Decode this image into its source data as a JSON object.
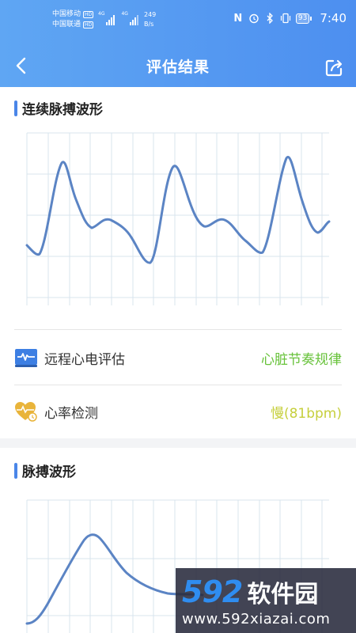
{
  "status_bar": {
    "carrier1": "中国移动",
    "carrier2": "中国联通",
    "hd": "HD",
    "net1": "4G",
    "net2": "4G",
    "speed_value": "249",
    "speed_unit": "B/s",
    "nfc_glyph": "N",
    "battery": "93",
    "time": "7:40"
  },
  "nav": {
    "title": "评估结果"
  },
  "section1": {
    "title": "连续脉搏波形"
  },
  "rows": [
    {
      "label": "远程心电评估",
      "value": "心脏节奏规律",
      "color": "#67c23a",
      "icon": "ecg-monitor-icon"
    },
    {
      "label": "心率检测",
      "value": "慢(81bpm)",
      "color": "#c6cf3c",
      "icon": "heart-rate-icon"
    }
  ],
  "section2": {
    "title": "脉搏波形"
  },
  "watermark": {
    "digits": "592",
    "brand": "软件园",
    "url": "www.592xiazai.com"
  },
  "colors": {
    "header_start": "#5fa6f3",
    "header_end": "#4d8ff0",
    "accent": "#4a86e8",
    "wave": "#5b84c4",
    "grid": "#d9e4ee"
  }
}
